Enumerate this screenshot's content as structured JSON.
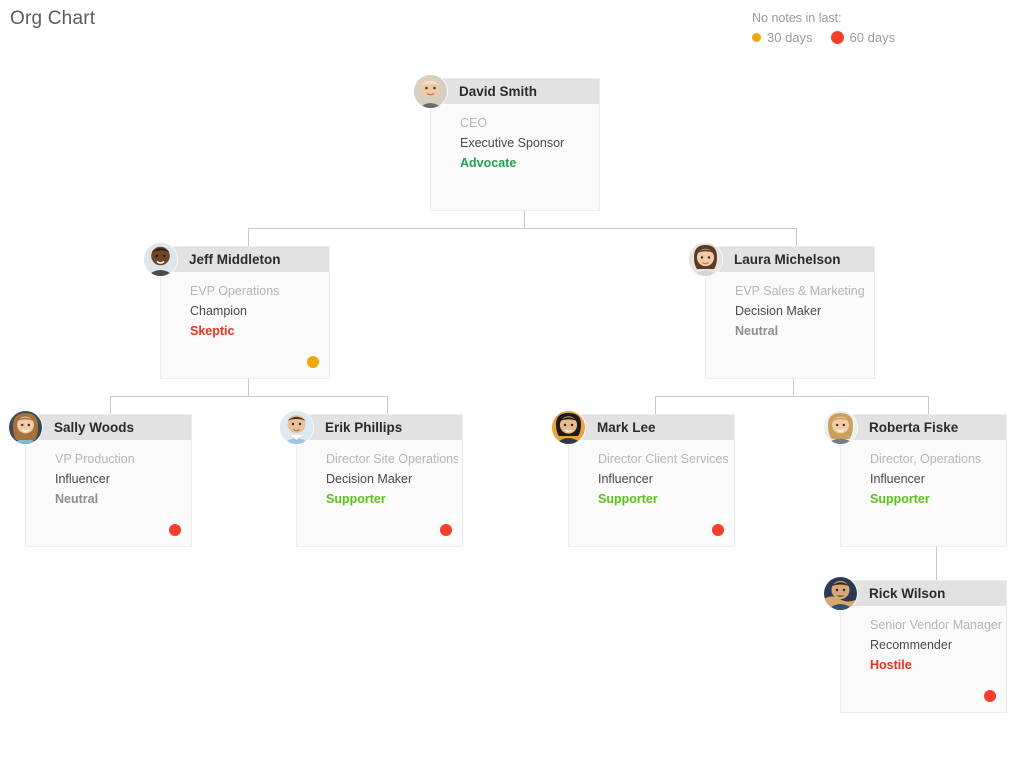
{
  "page": {
    "title": "Org Chart"
  },
  "legend": {
    "title": "No notes in last:",
    "items": [
      {
        "label": "30 days",
        "color": "#efa800",
        "dot": "small-yellow-dot"
      },
      {
        "label": "60 days",
        "color": "#f4402a",
        "dot": "large-red-dot"
      }
    ]
  },
  "colors": {
    "card_header_bg": "#e2e2e2",
    "card_body_bg": "#fafafa",
    "connector": "#c9c9c9",
    "advocate": "#22a24a",
    "supporter": "#5ec21b",
    "neutral": "#8d8d8d",
    "skeptic": "#f0301c",
    "hostile": "#f0301c"
  },
  "chart_data": {
    "type": "org-chart",
    "title": "Org Chart",
    "nodes": [
      {
        "id": "david-smith",
        "name": "David Smith",
        "role": "CEO",
        "influence": "Executive Sponsor",
        "attitude": "Advocate",
        "attitude_class": "advocate",
        "badge": null,
        "parent": null
      },
      {
        "id": "jeff-middleton",
        "name": "Jeff Middleton",
        "role": "EVP Operations",
        "influence": "Champion",
        "attitude": "Skeptic",
        "attitude_class": "skeptic",
        "badge": "30",
        "parent": "david-smith"
      },
      {
        "id": "laura-michelson",
        "name": "Laura Michelson",
        "role": "EVP Sales & Marketing",
        "influence": "Decision Maker",
        "attitude": "Neutral",
        "attitude_class": "neutral",
        "badge": null,
        "parent": "david-smith"
      },
      {
        "id": "sally-woods",
        "name": "Sally Woods",
        "role": "VP Production",
        "influence": "Influencer",
        "attitude": "Neutral",
        "attitude_class": "neutral",
        "badge": "60",
        "parent": "jeff-middleton"
      },
      {
        "id": "erik-phillips",
        "name": "Erik Phillips",
        "role": "Director Site Operations",
        "influence": "Decision Maker",
        "attitude": "Supporter",
        "attitude_class": "supporter",
        "badge": "60",
        "parent": "jeff-middleton"
      },
      {
        "id": "mark-lee",
        "name": "Mark Lee",
        "role": "Director Client Services",
        "influence": "Influencer",
        "attitude": "Supporter",
        "attitude_class": "supporter",
        "badge": "60",
        "parent": "laura-michelson"
      },
      {
        "id": "roberta-fiske",
        "name": "Roberta Fiske",
        "role": "Director, Operations",
        "influence": "Influencer",
        "attitude": "Supporter",
        "attitude_class": "supporter",
        "badge": null,
        "parent": "laura-michelson"
      },
      {
        "id": "rick-wilson",
        "name": "Rick Wilson",
        "role": "Senior Vendor Manager",
        "influence": "Recommender",
        "attitude": "Hostile",
        "attitude_class": "hostile",
        "badge": "60",
        "parent": "roberta-fiske"
      }
    ]
  }
}
